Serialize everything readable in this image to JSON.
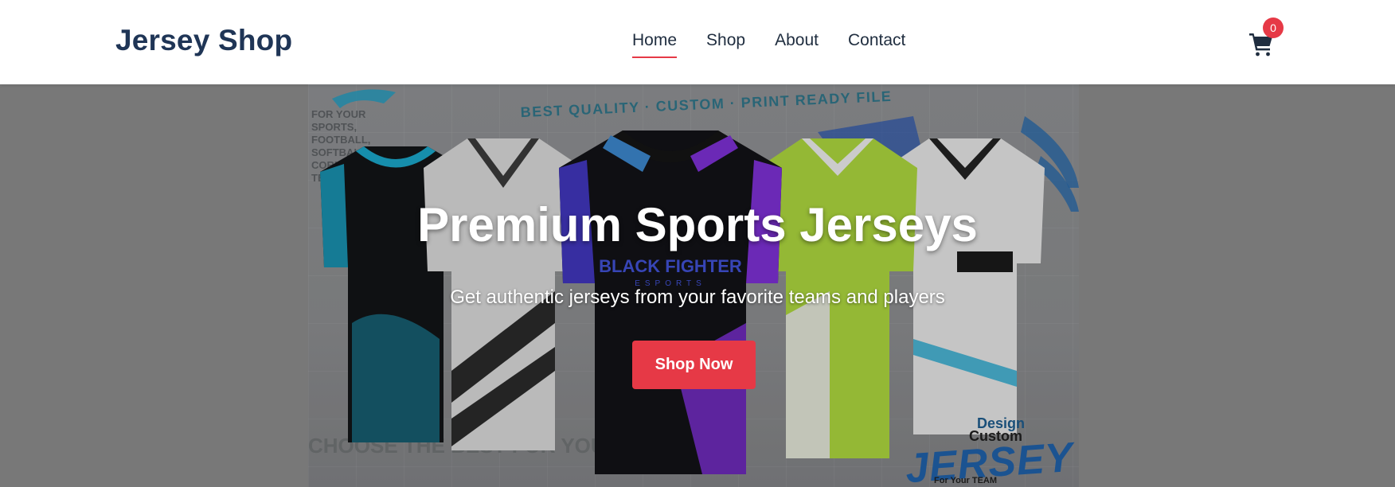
{
  "header": {
    "logo": "Jersey Shop",
    "nav": [
      {
        "label": "Home",
        "active": true
      },
      {
        "label": "Shop",
        "active": false
      },
      {
        "label": "About",
        "active": false
      },
      {
        "label": "Contact",
        "active": false
      }
    ],
    "cart_icon": "cart-icon",
    "cart_count": "0"
  },
  "hero": {
    "title": "Premium Sports Jerseys",
    "subtitle": "Get authentic jerseys from your favorite teams and players",
    "cta_label": "Shop Now"
  },
  "banner": {
    "strip_text": "BEST QUALITY · CUSTOM · PRINT READY FILE",
    "side_text": "FOR YOUR SPORTS, FOOTBALL, SOFTBALL, CORNHOLE TEAM",
    "bottom_left_text": "CHOOSE THE BEST FOR YOUR TEAM",
    "brand_design": "Design",
    "brand_custom": "Custom",
    "brand_jersey": "JERSEY",
    "brand_team": "For Your TEAM",
    "center_jersey_text": "BLACK FIGHTER",
    "center_jersey_sub": "ESPORTS"
  },
  "colors": {
    "brand": "#1f3556",
    "accent": "#e63946",
    "header_bg": "#ffffff"
  }
}
